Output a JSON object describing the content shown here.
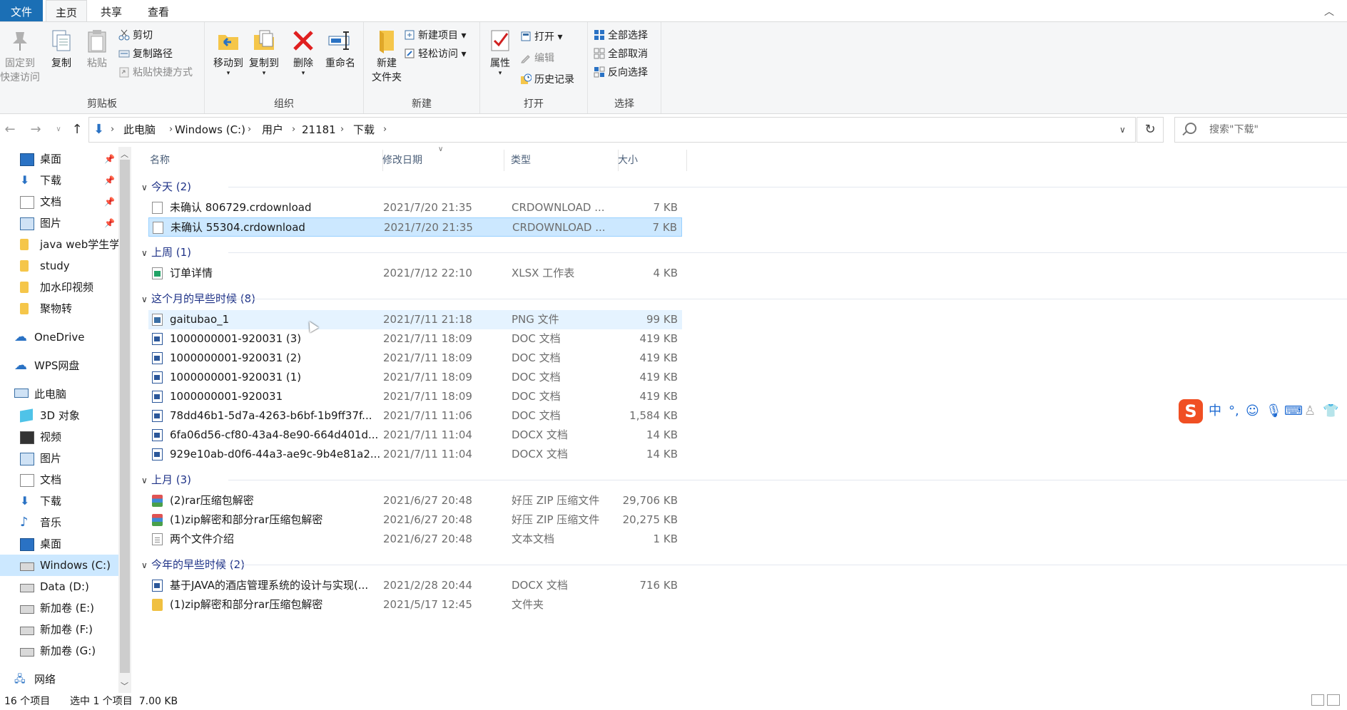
{
  "menu": {
    "file": "文件",
    "home": "主页",
    "share": "共享",
    "view": "查看"
  },
  "ribbon": {
    "clipboard": {
      "label": "剪贴板",
      "pin": "固定到\n快速访问",
      "copy": "复制",
      "paste": "粘贴",
      "cut": "剪切",
      "copy_path": "复制路径",
      "paste_shortcut": "粘贴快捷方式"
    },
    "organize": {
      "label": "组织",
      "move_to": "移动到",
      "copy_to": "复制到",
      "delete": "删除",
      "rename": "重命名"
    },
    "new": {
      "label": "新建",
      "new_folder": "新建\n文件夹",
      "new_item": "新建项目",
      "easy_access": "轻松访问"
    },
    "open": {
      "label": "打开",
      "properties": "属性",
      "open": "打开",
      "edit": "编辑",
      "history": "历史记录"
    },
    "select": {
      "label": "选择",
      "select_all": "全部选择",
      "select_none": "全部取消",
      "invert": "反向选择"
    }
  },
  "address": {
    "crumbs": [
      "此电脑",
      "Windows (C:)",
      "用户",
      "21181",
      "下载"
    ],
    "search_placeholder": "搜索\"下载\""
  },
  "nav": {
    "quick": [
      {
        "label": "桌面",
        "icon": "desktop-icon",
        "pinned": true
      },
      {
        "label": "下载",
        "icon": "download-icon",
        "pinned": true
      },
      {
        "label": "文档",
        "icon": "document-icon",
        "pinned": true
      },
      {
        "label": "图片",
        "icon": "picture-icon",
        "pinned": true
      },
      {
        "label": "java web学生学",
        "icon": "folder-icon",
        "pinned": false
      },
      {
        "label": "study",
        "icon": "folder-icon",
        "pinned": false
      },
      {
        "label": "加水印视频",
        "icon": "folder-icon",
        "pinned": false
      },
      {
        "label": "聚物转",
        "icon": "folder-icon",
        "pinned": false
      }
    ],
    "onedrive": "OneDrive",
    "wps": "WPS网盘",
    "thispc": "此电脑",
    "pc_items": [
      {
        "label": "3D 对象",
        "icon": "3d-objects-icon"
      },
      {
        "label": "视频",
        "icon": "video-icon"
      },
      {
        "label": "图片",
        "icon": "picture-icon"
      },
      {
        "label": "文档",
        "icon": "document-icon"
      },
      {
        "label": "下载",
        "icon": "download-icon"
      },
      {
        "label": "音乐",
        "icon": "music-icon"
      },
      {
        "label": "桌面",
        "icon": "desktop-icon"
      },
      {
        "label": "Windows (C:)",
        "icon": "drive-icon"
      },
      {
        "label": "Data (D:)",
        "icon": "drive-icon"
      },
      {
        "label": "新加卷 (E:)",
        "icon": "drive-icon"
      },
      {
        "label": "新加卷 (F:)",
        "icon": "drive-icon"
      },
      {
        "label": "新加卷 (G:)",
        "icon": "drive-icon"
      }
    ],
    "network": "网络"
  },
  "columns": {
    "name": "名称",
    "date": "修改日期",
    "type": "类型",
    "size": "大小"
  },
  "groups": [
    {
      "title": "今天 (2)",
      "files": [
        {
          "name": "未确认 806729.crdownload",
          "date": "2021/7/20 21:35",
          "type": "CRDOWNLOAD ...",
          "size": "7 KB",
          "icon": "generic"
        },
        {
          "name": "未确认 55304.crdownload",
          "date": "2021/7/20 21:35",
          "type": "CRDOWNLOAD ...",
          "size": "7 KB",
          "icon": "generic"
        }
      ]
    },
    {
      "title": "上周 (1)",
      "files": [
        {
          "name": "订单详情",
          "date": "2021/7/12 22:10",
          "type": "XLSX 工作表",
          "size": "4 KB",
          "icon": "xls"
        }
      ]
    },
    {
      "title": "这个月的早些时候 (8)",
      "files": [
        {
          "name": "gaitubao_1",
          "date": "2021/7/11 21:18",
          "type": "PNG 文件",
          "size": "99 KB",
          "icon": "png"
        },
        {
          "name": "1000000001-920031 (3)",
          "date": "2021/7/11 18:09",
          "type": "DOC 文档",
          "size": "419 KB",
          "icon": "word"
        },
        {
          "name": "1000000001-920031 (2)",
          "date": "2021/7/11 18:09",
          "type": "DOC 文档",
          "size": "419 KB",
          "icon": "word"
        },
        {
          "name": "1000000001-920031 (1)",
          "date": "2021/7/11 18:09",
          "type": "DOC 文档",
          "size": "419 KB",
          "icon": "word"
        },
        {
          "name": "1000000001-920031",
          "date": "2021/7/11 18:09",
          "type": "DOC 文档",
          "size": "419 KB",
          "icon": "word"
        },
        {
          "name": "78dd46b1-5d7a-4263-b6bf-1b9ff37f...",
          "date": "2021/7/11 11:06",
          "type": "DOC 文档",
          "size": "1,584 KB",
          "icon": "word"
        },
        {
          "name": "6fa06d56-cf80-43a4-8e90-664d401d...",
          "date": "2021/7/11 11:04",
          "type": "DOCX 文档",
          "size": "14 KB",
          "icon": "word"
        },
        {
          "name": "929e10ab-d0f6-44a3-ae9c-9b4e81a2...",
          "date": "2021/7/11 11:04",
          "type": "DOCX 文档",
          "size": "14 KB",
          "icon": "word"
        }
      ]
    },
    {
      "title": "上月 (3)",
      "files": [
        {
          "name": "(2)rar压缩包解密",
          "date": "2021/6/27 20:48",
          "type": "好压 ZIP 压缩文件",
          "size": "29,706 KB",
          "icon": "zip"
        },
        {
          "name": "(1)zip解密和部分rar压缩包解密",
          "date": "2021/6/27 20:48",
          "type": "好压 ZIP 压缩文件",
          "size": "20,275 KB",
          "icon": "zip"
        },
        {
          "name": "两个文件介绍",
          "date": "2021/6/27 20:48",
          "type": "文本文档",
          "size": "1 KB",
          "icon": "txt"
        }
      ]
    },
    {
      "title": "今年的早些时候 (2)",
      "files": [
        {
          "name": "基于JAVA的酒店管理系统的设计与实现(...",
          "date": "2021/2/28 20:44",
          "type": "DOCX 文档",
          "size": "716 KB",
          "icon": "word"
        },
        {
          "name": "(1)zip解密和部分rar压缩包解密",
          "date": "2021/5/17 12:45",
          "type": "文件夹",
          "size": "",
          "icon": "folder"
        }
      ]
    }
  ],
  "status": {
    "count": "16 个项目",
    "selected": "选中 1 个项目  7.00 KB"
  },
  "ime": {
    "logo": "S",
    "mode": "中",
    "punct": "°,"
  }
}
